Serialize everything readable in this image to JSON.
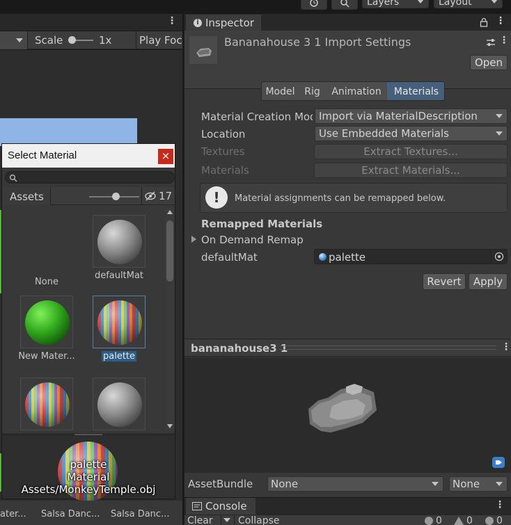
{
  "topbar": {
    "layers": "Layers",
    "layout": "Layout"
  },
  "scene": {
    "scale_label": "Scale",
    "scale_value": "1x",
    "play_focus": "Play Foc"
  },
  "inspector": {
    "tab_title": "Inspector",
    "asset_title": "Bananahouse 3 1 Import Settings",
    "open_button": "Open",
    "tabs": [
      {
        "label": "Model"
      },
      {
        "label": "Rig"
      },
      {
        "label": "Animation"
      },
      {
        "label": "Materials"
      }
    ],
    "fields": {
      "creation_mode_label": "Material Creation Mod",
      "creation_mode_value": "Import via MaterialDescription",
      "location_label": "Location",
      "location_value": "Use Embedded Materials",
      "textures_label": "Textures",
      "extract_textures": "Extract Textures...",
      "materials_label": "Materials",
      "extract_materials": "Extract Materials..."
    },
    "info_message": "Material assignments can be remapped below.",
    "remapped_header": "Remapped Materials",
    "on_demand_remap": "On Demand Remap",
    "default_mat_label": "defaultMat",
    "default_mat_value": "palette",
    "revert_button": "Revert",
    "apply_button": "Apply",
    "preview_title": "bananahouse3 1",
    "assetbundle_label": "AssetBundle",
    "assetbundle_value": "None",
    "assetbundle_variant": "None"
  },
  "console": {
    "tab_title": "Console",
    "clear": "Clear",
    "collapse": "Collapse",
    "count_info": "0",
    "count_warn": "0",
    "count_error": "0"
  },
  "select_material": {
    "title": "Select Material",
    "close": "×",
    "tab_assets": "Assets",
    "hidden_count": "17",
    "items": [
      {
        "label": "None"
      },
      {
        "label": "defaultMat"
      },
      {
        "label": "New Mater..."
      },
      {
        "label": "palette"
      }
    ],
    "preview_name": "palette",
    "preview_type": "Material",
    "preview_path": "Assets/MonkeyTemple.obj"
  },
  "project_bottom": {
    "items": [
      "ater...",
      "Salsa Danc...",
      "Salsa Danc..."
    ]
  }
}
